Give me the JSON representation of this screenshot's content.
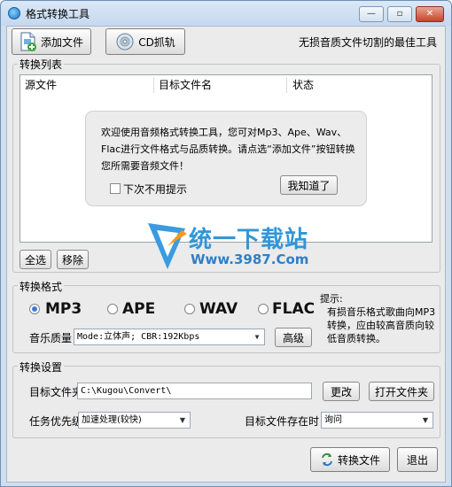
{
  "window": {
    "title": "格式转换工具",
    "controls": {
      "minimize": "—",
      "maximize": "▫",
      "close": "✕"
    }
  },
  "toolbar": {
    "add_file": "添加文件",
    "cd_rip": "CD抓轨",
    "slogan": "无损音质文件切割的最佳工具"
  },
  "convert_list": {
    "group_label": "转换列表",
    "columns": [
      "源文件",
      "目标文件名",
      "状态"
    ],
    "select_all": "全选",
    "remove": "移除"
  },
  "tip_popup": {
    "message": "欢迎使用音频格式转换工具，您可对Mp3、Ape、Wav、Flac进行文件格式与品质转换。请点选“添加文件”按钮转换您所需要音频文件！",
    "dont_show": "下次不用提示",
    "ok_button": "我知道了"
  },
  "watermark": {
    "name": "统一下载站",
    "url": "Www.3987.Com"
  },
  "format_group": {
    "group_label": "转换格式",
    "formats": [
      {
        "label": "MP3",
        "selected": true
      },
      {
        "label": "APE",
        "selected": false
      },
      {
        "label": "WAV",
        "selected": false
      },
      {
        "label": "FLAC",
        "selected": false
      }
    ],
    "quality_label": "音乐质量",
    "quality_value": "Mode:立体声; CBR:192Kbps",
    "advanced": "高级",
    "hint_title": "提示:",
    "hint_text": "有损音乐格式歌曲向MP3转换，应由较高音质向较低音质转换。"
  },
  "settings_group": {
    "group_label": "转换设置",
    "target_folder_label": "目标文件夹",
    "target_folder_value": "C:\\Kugou\\Convert\\",
    "change": "更改",
    "open_folder": "打开文件夹",
    "priority_label": "任务优先级",
    "priority_value": "加速处理(较快)",
    "exists_label": "目标文件存在时",
    "exists_value": "询问"
  },
  "footer": {
    "convert": "转换文件",
    "exit": "退出"
  }
}
